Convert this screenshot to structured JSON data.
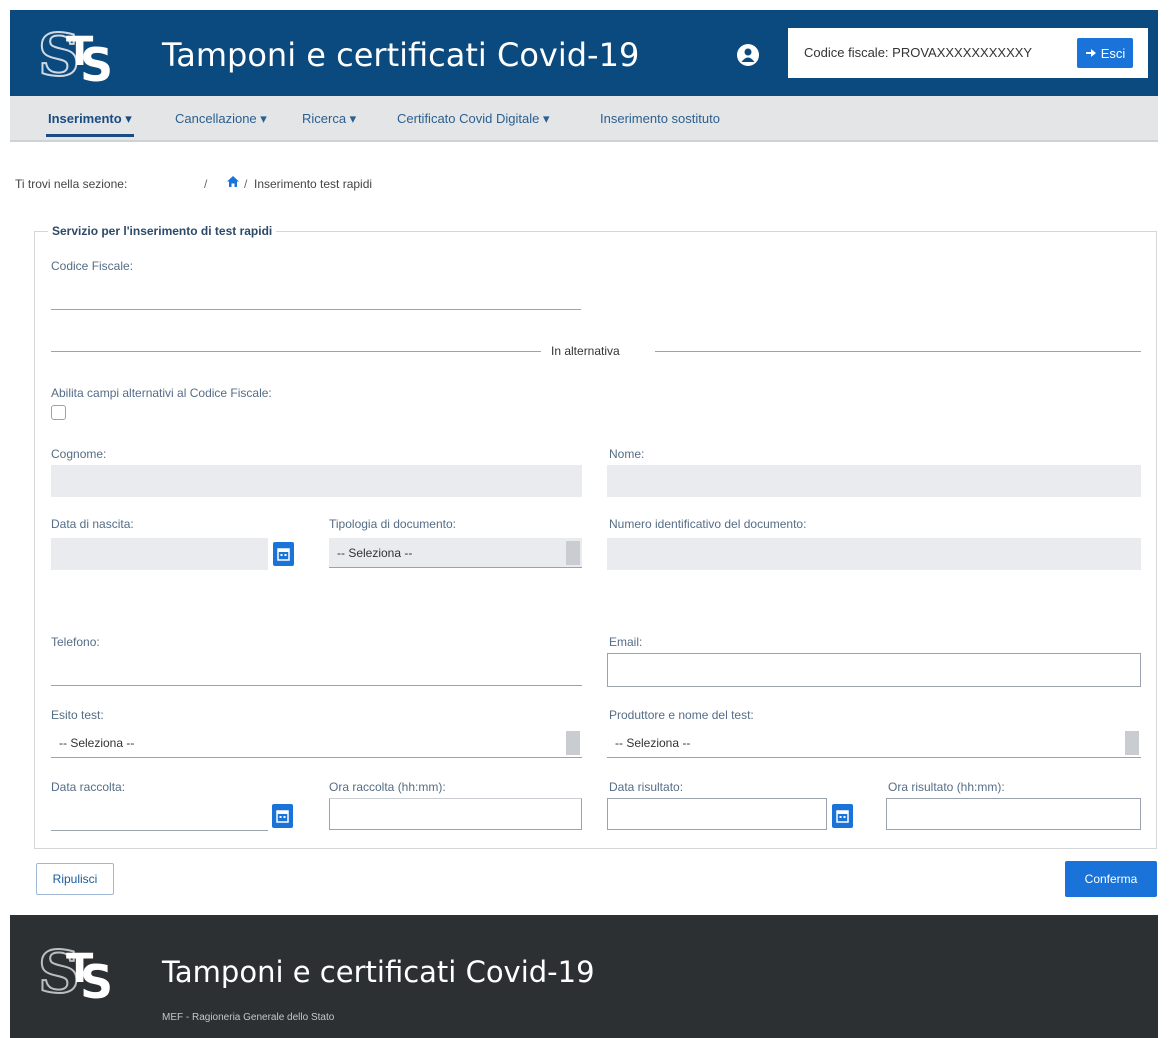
{
  "header": {
    "app_title": "Tamponi e certificati Covid-19",
    "codice_fiscale_text": "Codice fiscale: PROVAXXXXXXXXXXY",
    "exit_label": "Esci"
  },
  "nav": {
    "items": [
      {
        "label": "Inserimento ▾"
      },
      {
        "label": "Cancellazione ▾"
      },
      {
        "label": "Ricerca ▾"
      },
      {
        "label": "Certificato Covid Digitale ▾"
      },
      {
        "label": "Inserimento sostituto"
      }
    ]
  },
  "breadcrumb": {
    "prefix": "Ti trovi nella sezione:",
    "sep1": "/",
    "sep2": "/",
    "current": "Inserimento test rapidi"
  },
  "form": {
    "legend": "Servizio per l'inserimento di test rapidi",
    "codice_fiscale_label": "Codice Fiscale:",
    "alternative_text": "In alternativa",
    "enable_alt_label": "Abilita campi alternativi al Codice Fiscale:",
    "cognome_label": "Cognome:",
    "nome_label": "Nome:",
    "data_nascita_label": "Data di nascita:",
    "tipologia_label": "Tipologia di documento:",
    "tipologia_value": "-- Seleziona --",
    "numero_doc_label": "Numero identificativo del documento:",
    "telefono_label": "Telefono:",
    "email_label": "Email:",
    "esito_label": "Esito test:",
    "esito_value": "-- Seleziona --",
    "produttore_label": "Produttore e nome del test:",
    "produttore_value": "-- Seleziona --",
    "data_raccolta_label": "Data raccolta:",
    "ora_raccolta_label": "Ora raccolta (hh:mm):",
    "data_risultato_label": "Data risultato:",
    "ora_risultato_label": "Ora risultato (hh:mm):"
  },
  "actions": {
    "clear_label": "Ripulisci",
    "confirm_label": "Conferma"
  },
  "footer": {
    "title": "Tamponi e certificati Covid-19",
    "subtitle": "MEF - Ragioneria Generale dello Stato"
  },
  "colors": {
    "header_bg": "#0b4a7e",
    "accent": "#1a73d9",
    "footer_bg": "#2d3033"
  }
}
